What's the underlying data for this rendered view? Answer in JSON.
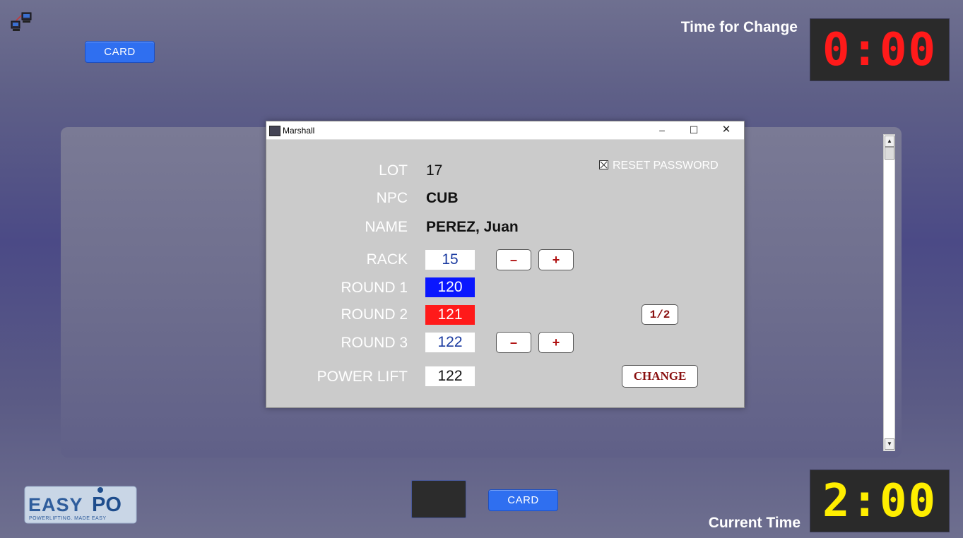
{
  "top_bar": {
    "network_icon": "network-computers-icon",
    "card_label": "CARD",
    "time_for_change_label": "Time for Change",
    "time_for_change_value": "0:00"
  },
  "bottom_bar": {
    "logo_text": "EASYPO",
    "logo_tagline": "POWERLIFTING. MADE EASY",
    "card_label": "CARD",
    "current_time_label": "Current Time",
    "current_time_value": "2:00"
  },
  "colors": {
    "change_clock": "#ff1a1a",
    "current_clock": "#ffee00",
    "round1_bg": "#0a17ff",
    "round2_bg": "#ff1a1a",
    "card_button": "#2f6ff0"
  },
  "dialog": {
    "title": "Marshall",
    "minimize": "–",
    "maximize": "☐",
    "close": "✕",
    "reset_password_label": "RESET PASSWORD",
    "fields": {
      "lot_label": "LOT",
      "lot_value": "17",
      "npc_label": "NPC",
      "npc_value": "CUB",
      "name_label": "NAME",
      "name_value": "PEREZ, Juan",
      "rack_label": "RACK",
      "rack_value": "15",
      "round1_label": "ROUND 1",
      "round1_value": "120",
      "round2_label": "ROUND 2",
      "round2_value": "121",
      "round3_label": "ROUND 3",
      "round3_value": "122",
      "power_lift_label": "POWER LIFT",
      "power_lift_value": "122"
    },
    "buttons": {
      "minus": "–",
      "plus": "+",
      "half": "1/2",
      "change": "CHANGE"
    }
  }
}
